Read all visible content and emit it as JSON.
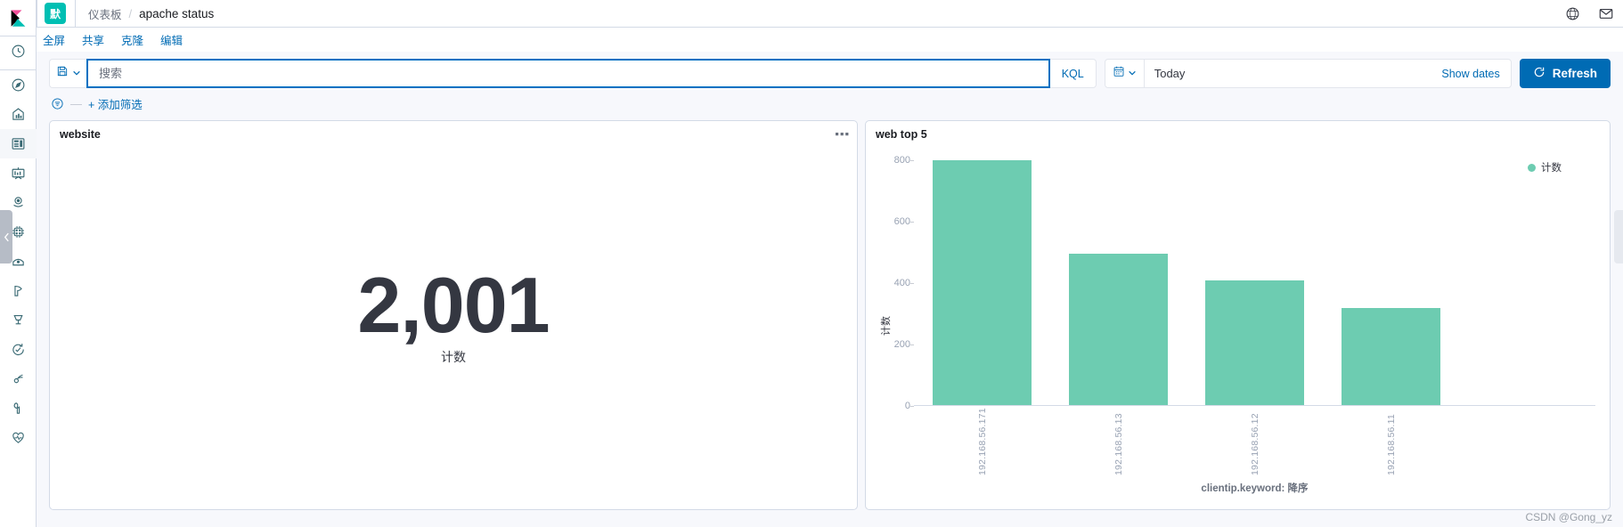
{
  "brand": {
    "space_initial": "默",
    "space_color": "#00bfb3"
  },
  "breadcrumb": {
    "parent": "仪表板",
    "separator": "/",
    "current": "apache status"
  },
  "header_icons": {
    "help": "help-icon",
    "mail": "mail-icon"
  },
  "sidebar": {
    "items": [
      {
        "name": "recently-viewed",
        "icon": "clock-icon"
      },
      {
        "name": "discover",
        "icon": "compass-icon"
      },
      {
        "name": "visualize",
        "icon": "bar-chart-icon"
      },
      {
        "name": "dashboard",
        "icon": "dashboard-icon",
        "active": true
      },
      {
        "name": "canvas",
        "icon": "presentation-icon"
      },
      {
        "name": "maps",
        "icon": "globe-pin-icon"
      },
      {
        "name": "machine-learning",
        "icon": "ml-icon"
      },
      {
        "name": "infrastructure",
        "icon": "infra-icon"
      },
      {
        "name": "logs",
        "icon": "logs-icon"
      },
      {
        "name": "apm",
        "icon": "apm-icon"
      },
      {
        "name": "uptime",
        "icon": "uptime-icon"
      },
      {
        "name": "siem",
        "icon": "siem-icon"
      },
      {
        "name": "dev-tools",
        "icon": "wrench-icon"
      },
      {
        "name": "monitoring",
        "icon": "heartbeat-icon"
      }
    ]
  },
  "actions": {
    "fullscreen": "全屏",
    "share": "共享",
    "clone": "克隆",
    "edit": "编辑"
  },
  "query": {
    "save_icon": "save-query-icon",
    "chevron_icon": "chevron-down-icon",
    "placeholder": "搜索",
    "value": "",
    "language": "KQL"
  },
  "datepicker": {
    "calendar_icon": "calendar-icon",
    "chevron_icon": "chevron-down-icon",
    "value": "Today",
    "show_dates": "Show dates"
  },
  "refresh": {
    "icon": "refresh-icon",
    "label": "Refresh"
  },
  "filters": {
    "icon": "filter-icon",
    "dash": "—",
    "add_label": "+ 添加筛选"
  },
  "panels": {
    "metric": {
      "title": "website",
      "menu_icon": "panel-options-icon",
      "value": "2,001",
      "label": "计数"
    },
    "bar": {
      "title": "web top 5",
      "menu_icon": "panel-options-icon"
    }
  },
  "chart_data": {
    "type": "bar",
    "title": "web top 5",
    "categories": [
      "192.168.56.171",
      "192.168.56.13",
      "192.168.56.12",
      "192.168.56.11",
      ""
    ],
    "values": [
      800,
      495,
      410,
      320,
      0
    ],
    "series": [
      {
        "name": "计数",
        "values": [
          800,
          495,
          410,
          320,
          0
        ]
      }
    ],
    "xlabel": "clientip.keyword: 降序",
    "ylabel": "计数",
    "ylim": [
      0,
      800
    ],
    "yticks": [
      0,
      200,
      400,
      600,
      800
    ],
    "bar_color": "#6dccb1",
    "legend": {
      "position": "top-right",
      "entries": [
        "计数"
      ]
    },
    "grid": false
  },
  "watermark": "CSDN @Gong_yz"
}
